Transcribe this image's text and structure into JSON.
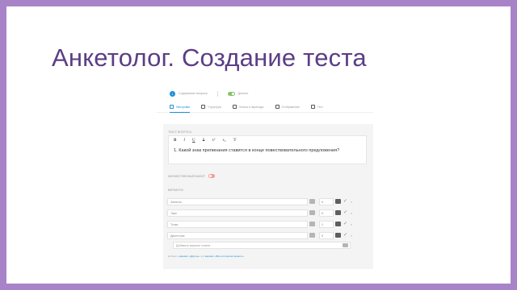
{
  "slide": {
    "title": "Анкетолог. Создание теста"
  },
  "topbar": {
    "step_number": "1",
    "step_label": "Содержание вопроса",
    "toggle_label": "Дополн."
  },
  "tabs": [
    {
      "label": "Настройки"
    },
    {
      "label": "Структура"
    },
    {
      "label": "Логика и переходы"
    },
    {
      "label": "Отображение"
    },
    {
      "label": "Тест"
    }
  ],
  "question": {
    "section_label": "ТЕКСТ ВОПРОСА",
    "toolbar": [
      "B",
      "I",
      "U",
      "S",
      "x²",
      "x₂",
      "T̸"
    ],
    "text": "1. Какой знак препинания ставится в конце повествовательного предложения?"
  },
  "multi_select_label": "МНОЖЕСТВЕННЫЙ ВЫБОР",
  "answers_title": "ВАРИАНТЫ",
  "answers": [
    {
      "text": "Запятая",
      "score": "0"
    },
    {
      "text": "Тире",
      "score": "0"
    },
    {
      "text": "Точка",
      "score": "1"
    },
    {
      "text": "Двоеточие",
      "score": "0"
    }
  ],
  "add_answer_placeholder": "Добавить вариант ответа",
  "footer": {
    "prefix": "Добавить ",
    "link1": "вариант «Другое»",
    "middle": " или ",
    "link2": "вариант «Все из перечисленного»"
  },
  "colors": {
    "background": "#a883c8",
    "title": "#5b3e85",
    "accent": "#1a8fd6"
  }
}
